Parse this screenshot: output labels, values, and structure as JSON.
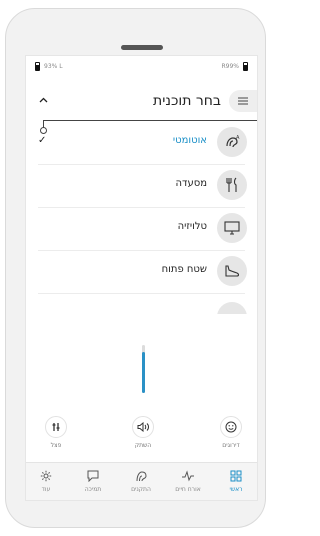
{
  "status_bar": {
    "left_battery": "93% L",
    "right_battery": "R99%"
  },
  "header": {
    "title": "בחר תוכנית"
  },
  "programs": [
    {
      "label": "אוטומטי",
      "icon": "automatic-ear-icon",
      "selected": true
    },
    {
      "label": "מסעדה",
      "icon": "restaurant-icon",
      "selected": false
    },
    {
      "label": "טלויזיה",
      "icon": "tv-icon",
      "selected": false
    },
    {
      "label": "שטח פתוח",
      "icon": "outdoor-shoe-icon",
      "selected": false
    }
  ],
  "volume": {
    "level": 0.85
  },
  "controls": {
    "equalizer_label": "פצל",
    "mute_label": "השתק",
    "mood_label": "דירוגים"
  },
  "tabs": [
    {
      "label": "עוד",
      "icon": "gear-icon"
    },
    {
      "label": "תמיכה",
      "icon": "chat-icon"
    },
    {
      "label": "התקנים",
      "icon": "hearing-aid-icon"
    },
    {
      "label": "אורח חיים",
      "icon": "pulse-icon"
    },
    {
      "label": "ראשי",
      "icon": "grid-icon",
      "active": true
    }
  ],
  "colors": {
    "accent": "#1a8fc7",
    "volume_fill": "#2a91c6"
  }
}
